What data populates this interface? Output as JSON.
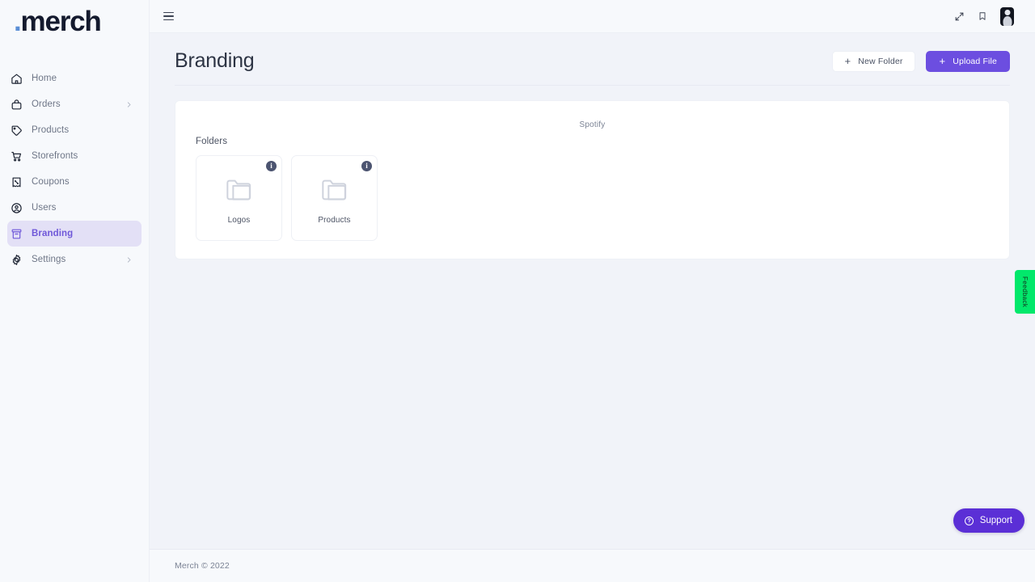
{
  "brand": {
    "logo_dot": ".",
    "logo_name": "merch",
    "accent_purple": "#6c4ee0",
    "accent_purple_dark": "#5b2fd6",
    "active_nav_bg": "#e3e0f6",
    "active_nav_text": "#6f58d9",
    "feedback_green": "#02e86b",
    "page_bg": "#f1f3f9",
    "sidebar_bg": "#f7f9fc"
  },
  "sidebar": {
    "items": [
      {
        "label": "Home",
        "icon": "home-icon",
        "chevron": false,
        "active": false
      },
      {
        "label": "Orders",
        "icon": "bag-icon",
        "chevron": true,
        "active": false
      },
      {
        "label": "Products",
        "icon": "tag-icon",
        "chevron": false,
        "active": false
      },
      {
        "label": "Storefronts",
        "icon": "cart-icon",
        "chevron": false,
        "active": false
      },
      {
        "label": "Coupons",
        "icon": "coupon-icon",
        "chevron": false,
        "active": false
      },
      {
        "label": "Users",
        "icon": "user-circle-icon",
        "chevron": false,
        "active": false
      },
      {
        "label": "Branding",
        "icon": "archive-icon",
        "chevron": false,
        "active": true
      },
      {
        "label": "Settings",
        "icon": "gear-icon",
        "chevron": true,
        "active": false
      }
    ]
  },
  "topbar": {
    "menu_icon": "hamburger-icon",
    "fullscreen_icon": "expand-icon",
    "bookmark_icon": "bookmark-icon",
    "avatar_icon": "avatar"
  },
  "page": {
    "title": "Branding",
    "actions": {
      "new_folder_label": "New Folder",
      "upload_file_label": "Upload File",
      "plus_glyph": "+"
    }
  },
  "card": {
    "breadcrumb": "Spotify",
    "folders_heading": "Folders",
    "folders": [
      {
        "name": "Logos",
        "icon": "folder-icon",
        "badge": "i"
      },
      {
        "name": "Products",
        "icon": "folder-icon",
        "badge": "i"
      }
    ]
  },
  "footer": {
    "copyright": "Merch © 2022"
  },
  "widgets": {
    "feedback_label": "Feedback",
    "support_label": "Support",
    "support_icon": "question-circle-icon"
  }
}
